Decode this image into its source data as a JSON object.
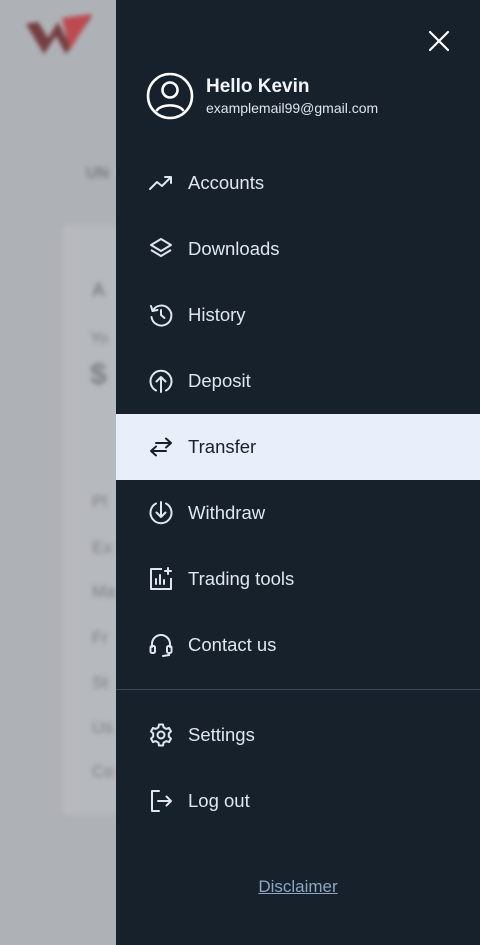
{
  "profile": {
    "greeting": "Hello Kevin",
    "email": "examplemail99@gmail.com"
  },
  "menu": [
    {
      "label": "Accounts",
      "icon": "trending-up-icon"
    },
    {
      "label": "Downloads",
      "icon": "layers-icon"
    },
    {
      "label": "History",
      "icon": "history-icon"
    },
    {
      "label": "Deposit",
      "icon": "upload-circle-icon"
    },
    {
      "label": "Transfer",
      "icon": "transfer-arrows-icon",
      "active": true
    },
    {
      "label": "Withdraw",
      "icon": "download-circle-icon"
    },
    {
      "label": "Trading tools",
      "icon": "chart-plus-icon"
    },
    {
      "label": "Contact us",
      "icon": "headset-icon"
    }
  ],
  "secondary_menu": [
    {
      "label": "Settings",
      "icon": "gear-icon"
    },
    {
      "label": "Log out",
      "icon": "logout-icon"
    }
  ],
  "disclaimer": "Disclaimer",
  "colors": {
    "drawer_bg": "#17212b",
    "active_bg": "#e9effa",
    "link": "#8ea6c4"
  }
}
